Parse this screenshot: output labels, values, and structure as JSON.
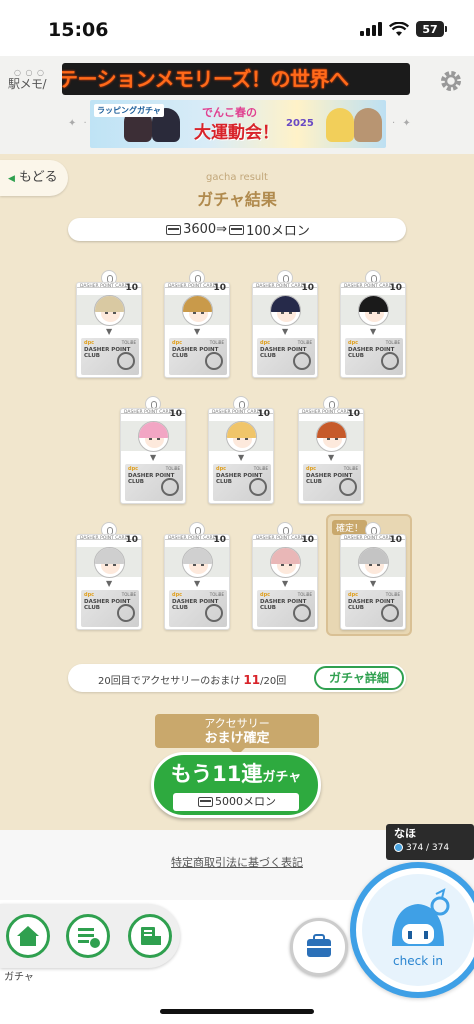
{
  "status": {
    "time": "15:06",
    "battery": "57"
  },
  "header": {
    "logo": "駅メモ/",
    "ticker": "テーションメモリーズ！の世界へ",
    "banner": {
      "tag": "ラッピングガチャ",
      "line1": "でんこ春の",
      "line2": "大運動会！",
      "year": "2025"
    }
  },
  "main": {
    "back_label": "もどる",
    "subtitle": "gacha result",
    "title": "ガチャ結果",
    "cost_from": "3600",
    "cost_arrow": "⇒",
    "cost_to": "100メロン",
    "card_header": "DASHER POINT CARD",
    "card_brand": "DASHER POINT CLUB",
    "card_value": "10",
    "confirmed_label": "確定！",
    "bonus_text_pre": "20回目でアクセサリーのおまけ",
    "bonus_current": "11",
    "bonus_total": "/20回",
    "detail_button": "ガチャ詳細",
    "accessory_line1": "アクセサリー",
    "accessory_line2": "おまけ確定",
    "again_main": "もう11連",
    "again_sub": "ガチャ",
    "again_cost": "5000メロン"
  },
  "footer": {
    "legal": "特定商取引法に基づく表記",
    "user_name": "なほ",
    "user_points": "374 / 374",
    "nav_label": "ガチャ",
    "checkin": "check in"
  },
  "icons": {
    "back": "triangle-left-icon",
    "home": "home-icon",
    "list": "list-icon",
    "shop": "shop-icon",
    "bag": "briefcase-icon",
    "gear": "gear-icon"
  },
  "colors": {
    "accent_green": "#2eaa3f",
    "gold": "#c9a86c",
    "checkin_blue": "#3fa0e6",
    "bg": "#f1e6cd"
  }
}
